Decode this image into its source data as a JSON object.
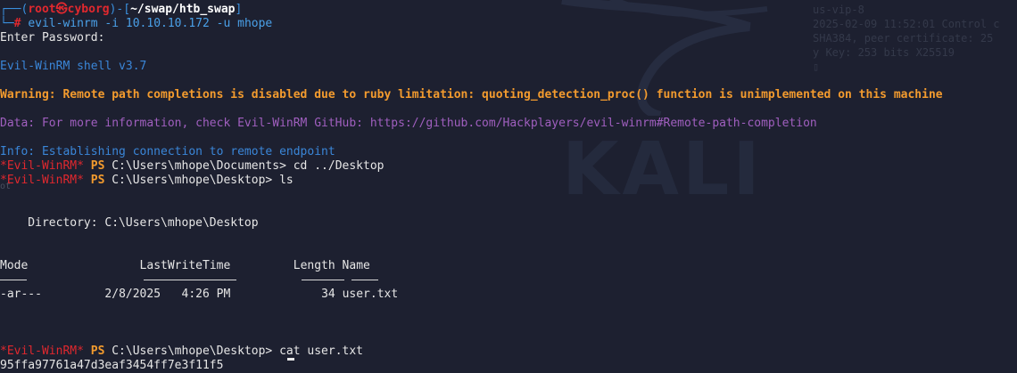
{
  "prompt": {
    "corner_top": "┌──(",
    "user": "root",
    "skull": "㉿",
    "host": "cyborg",
    "sep": ")-[",
    "path": "~/swap/htb_swap",
    "close": "]",
    "corner_bottom": "└─",
    "hash": "#",
    "cmd_name": "evil-winrm",
    "cmd_args": " -i 10.10.10.172 -u mhope"
  },
  "output": {
    "enter_password": "Enter Password:",
    "shell_version": "Evil-WinRM shell v3.7",
    "warning": "Warning: Remote path completions is disabled due to ruby limitation: quoting_detection_proc() function is unimplemented on this machine",
    "data": "Data: For more information, check Evil-WinRM GitHub: https://github.com/Hackplayers/evil-winrm#Remote-path-completion",
    "info": "Info: Establishing connection to remote endpoint"
  },
  "ps_lines": [
    {
      "tag": "*Evil-WinRM*",
      "ps": "PS",
      "cwd": "C:\\Users\\mhope\\Documents>",
      "command": " cd ../Desktop"
    },
    {
      "tag": "*Evil-WinRM*",
      "ps": "PS",
      "cwd": "C:\\Users\\mhope\\Desktop>",
      "command": " ls"
    },
    {
      "tag": "*Evil-WinRM*",
      "ps": "PS",
      "cwd": "C:\\Users\\mhope\\Desktop>",
      "command": " cat user.txt"
    }
  ],
  "listing": {
    "directory_line": "    Directory: C:\\Users\\mhope\\Desktop",
    "headers": {
      "mode": "Mode",
      "lastwrite": "LastWriteTime",
      "length": "Length",
      "name": "Name"
    },
    "rows": [
      {
        "mode": "-ar---",
        "date": "2/8/2025",
        "time": "4:26 PM",
        "length": "34",
        "name": "user.txt"
      }
    ]
  },
  "flag": "95ffa97761a47d3eaf3454ff7e3f11f5",
  "stray_char": "ot",
  "wallpaper": {
    "logo": "KALI",
    "widget_lines": [
      "us-vip-8",
      "2025-02-09 11:52:01 Control c",
      "SHA384, peer certificate: 25",
      "y Key: 253 bits X25519",
      "▯"
    ]
  }
}
